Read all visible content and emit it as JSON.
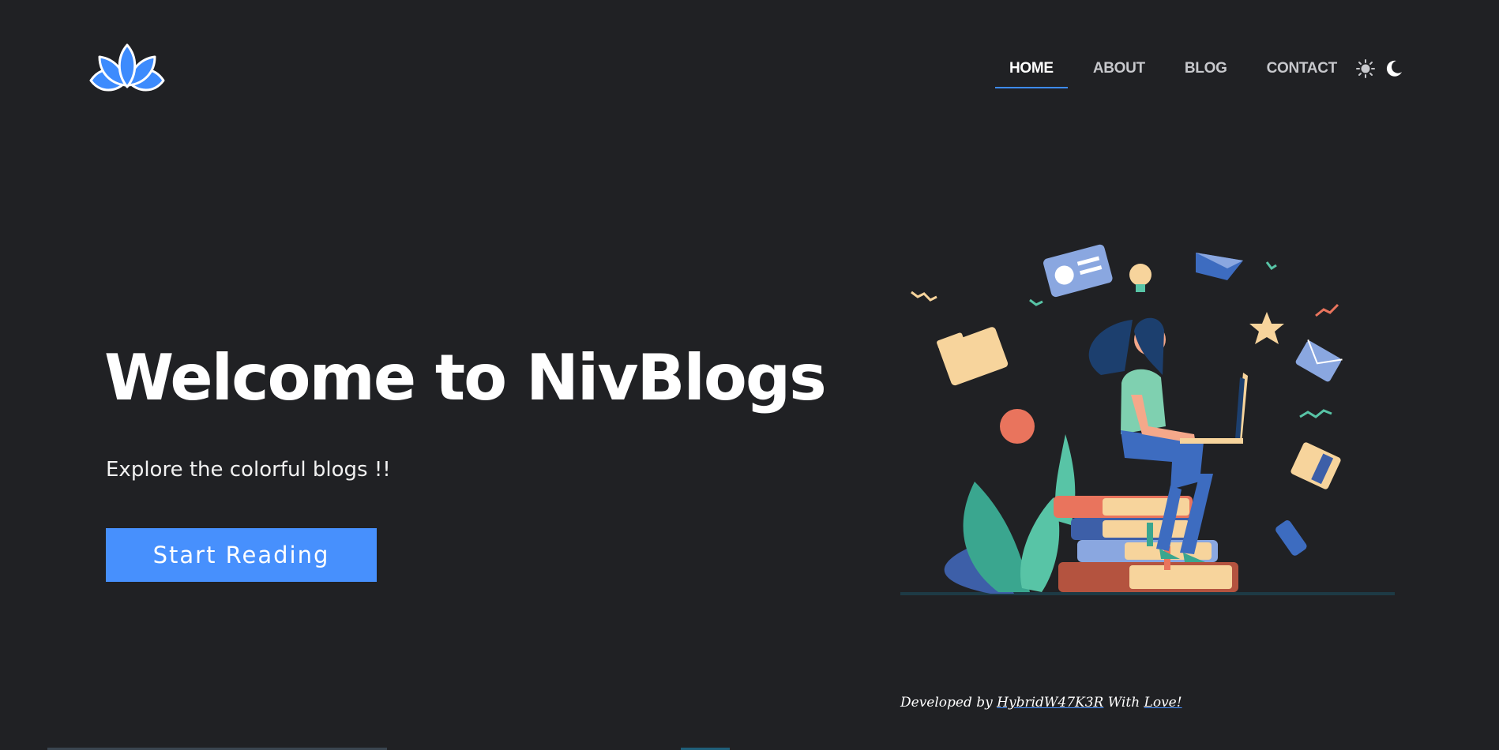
{
  "logo": {
    "icon": "lotus-logo-icon",
    "color": "#3d8bfd"
  },
  "nav": {
    "items": [
      {
        "label": "HOME",
        "active": true
      },
      {
        "label": "ABOUT",
        "active": false
      },
      {
        "label": "BLOG",
        "active": false
      },
      {
        "label": "CONTACT",
        "active": false
      }
    ],
    "theme_toggle": {
      "light_icon": "sun-icon",
      "dark_icon": "moon-icon"
    }
  },
  "hero": {
    "title": "Welcome to NivBlogs",
    "subtitle": "Explore the colorful blogs !!",
    "cta_label": "Start Reading",
    "illustration": "woman-reading-on-books-illustration"
  },
  "footer": {
    "prefix": "Developed by ",
    "author": "HybridW47K3R",
    "middle": " With ",
    "love": "Love!"
  },
  "colors": {
    "background": "#202124",
    "accent": "#4790fd",
    "text": "#ffffff",
    "nav_text": "#c7c8cc"
  }
}
